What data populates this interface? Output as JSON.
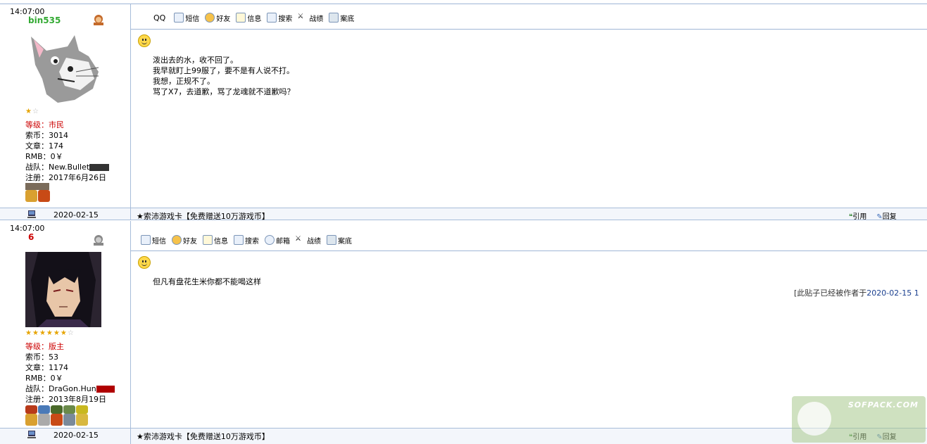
{
  "posts": [
    {
      "time": "14:07:00",
      "username": "bin535",
      "username_color": "#33aa33",
      "stars_full": 1,
      "stars_empty": 1,
      "level_label": "等级：市民",
      "coins": "索币：3014",
      "articles": "文章：174",
      "rmb": "RMB：0￥",
      "team": "战队：New.Bullet",
      "registered": "注册：2017年6月26日",
      "toolbar": {
        "qq": "QQ",
        "sms": "短信",
        "friend": "好友",
        "info": "信息",
        "search": "搜索",
        "mail": "",
        "record": "战绩",
        "case": "案底"
      },
      "body_lines": [
        "泼出去的水，收不回了。",
        "我早就盯上99服了，要不是有人说不打。",
        "我想，正规不了。",
        "骂了X7，去道歉，骂了龙魂就不道歉吗？"
      ],
      "footer_date": "2020-02-15",
      "footer_ad": "★索沛游戏卡【免费赠送10万游戏币】",
      "quote": "引用",
      "reply": "回复"
    },
    {
      "time": "14:07:00",
      "username": "6",
      "username_color": "#cc0000",
      "stars_full": 6,
      "stars_empty": 1,
      "level_label": "等级：版主",
      "coins": "索币：53",
      "articles": "文章：1174",
      "rmb": "RMB：0￥",
      "team": "战队：DraGon.Hun",
      "registered": "注册：2013年8月19日",
      "toolbar": {
        "qq": "",
        "sms": "短信",
        "friend": "好友",
        "info": "信息",
        "search": "搜索",
        "mail": "邮箱",
        "record": "战绩",
        "case": "案底"
      },
      "body_lines": [
        "但凡有盘花生米你都不能喝这样"
      ],
      "edit_note_prefix": "[此贴子已经被作者于",
      "edit_note_date": "2020-02-15 1",
      "footer_date": "2020-02-15",
      "footer_ad": "★索沛游戏卡【免费赠送10万游戏币】",
      "quote": "引用",
      "reply": "回复"
    }
  ],
  "watermark_text": "SOFPACK.COM",
  "colors": {
    "border": "#a7bcd9",
    "level": "#cc0000",
    "star": "#e6a400",
    "edit_date": "#1a3f8f"
  }
}
